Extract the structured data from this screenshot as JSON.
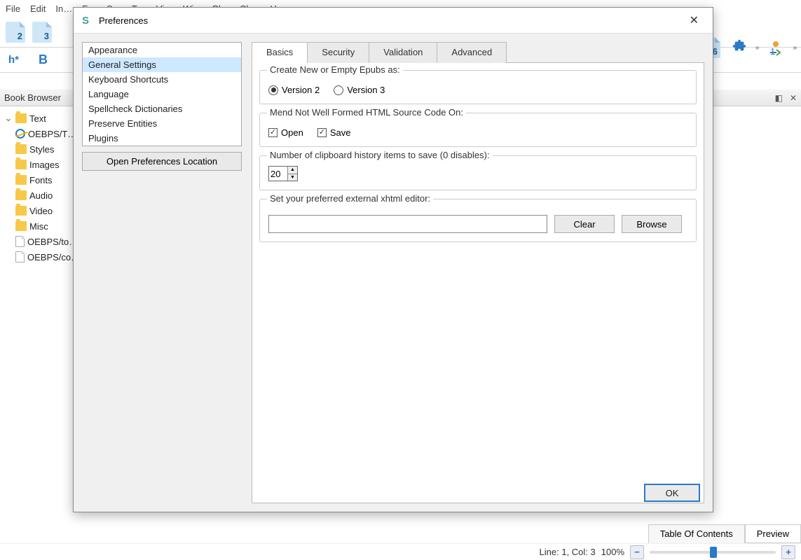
{
  "menubar": [
    "File",
    "Edit",
    "In…",
    "F…",
    "S…",
    "T…",
    "Vi…",
    "Wi…",
    "Pl…",
    "Ch…",
    "H…"
  ],
  "toolbar": {
    "h2": "2",
    "h3": "3",
    "hstar": "h*",
    "bold": "B",
    "six": "6",
    "plugins_chevron": "»",
    "checkpoints_chevron": "»"
  },
  "panels": {
    "book_browser_title": "Book Browser",
    "tree": {
      "text": "Text",
      "text_child": "OEBPS/T…",
      "styles": "Styles",
      "images": "Images",
      "fonts": "Fonts",
      "audio": "Audio",
      "video": "Video",
      "misc": "Misc",
      "toc": "OEBPS/to…",
      "co": "OEBPS/co…"
    }
  },
  "dialog": {
    "title": "Preferences",
    "side_items": [
      "Appearance",
      "General Settings",
      "Keyboard Shortcuts",
      "Language",
      "Spellcheck Dictionaries",
      "Preserve Entities",
      "Plugins"
    ],
    "side_selected_index": 1,
    "open_location": "Open Preferences Location",
    "tabs": [
      "Basics",
      "Security",
      "Validation",
      "Advanced"
    ],
    "active_tab": 0,
    "group_epub": {
      "legend": "Create New or Empty Epubs as:",
      "opt_v2": "Version 2",
      "opt_v3": "Version 3",
      "selected": "v2"
    },
    "group_mend": {
      "legend": "Mend Not Well Formed HTML Source Code On:",
      "open": "Open",
      "save": "Save",
      "open_checked": true,
      "save_checked": true
    },
    "group_clip": {
      "legend": "Number of clipboard history items to save (0 disables):",
      "value": "20"
    },
    "group_editor": {
      "legend": "Set your preferred external xhtml editor:",
      "value": "",
      "clear": "Clear",
      "browse": "Browse"
    },
    "ok": "OK"
  },
  "bottom": {
    "tab_toc": "Table Of Contents",
    "tab_preview": "Preview",
    "cursor": "Line: 1, Col: 3",
    "zoom": "100%",
    "minus": "−",
    "plus": "+"
  }
}
